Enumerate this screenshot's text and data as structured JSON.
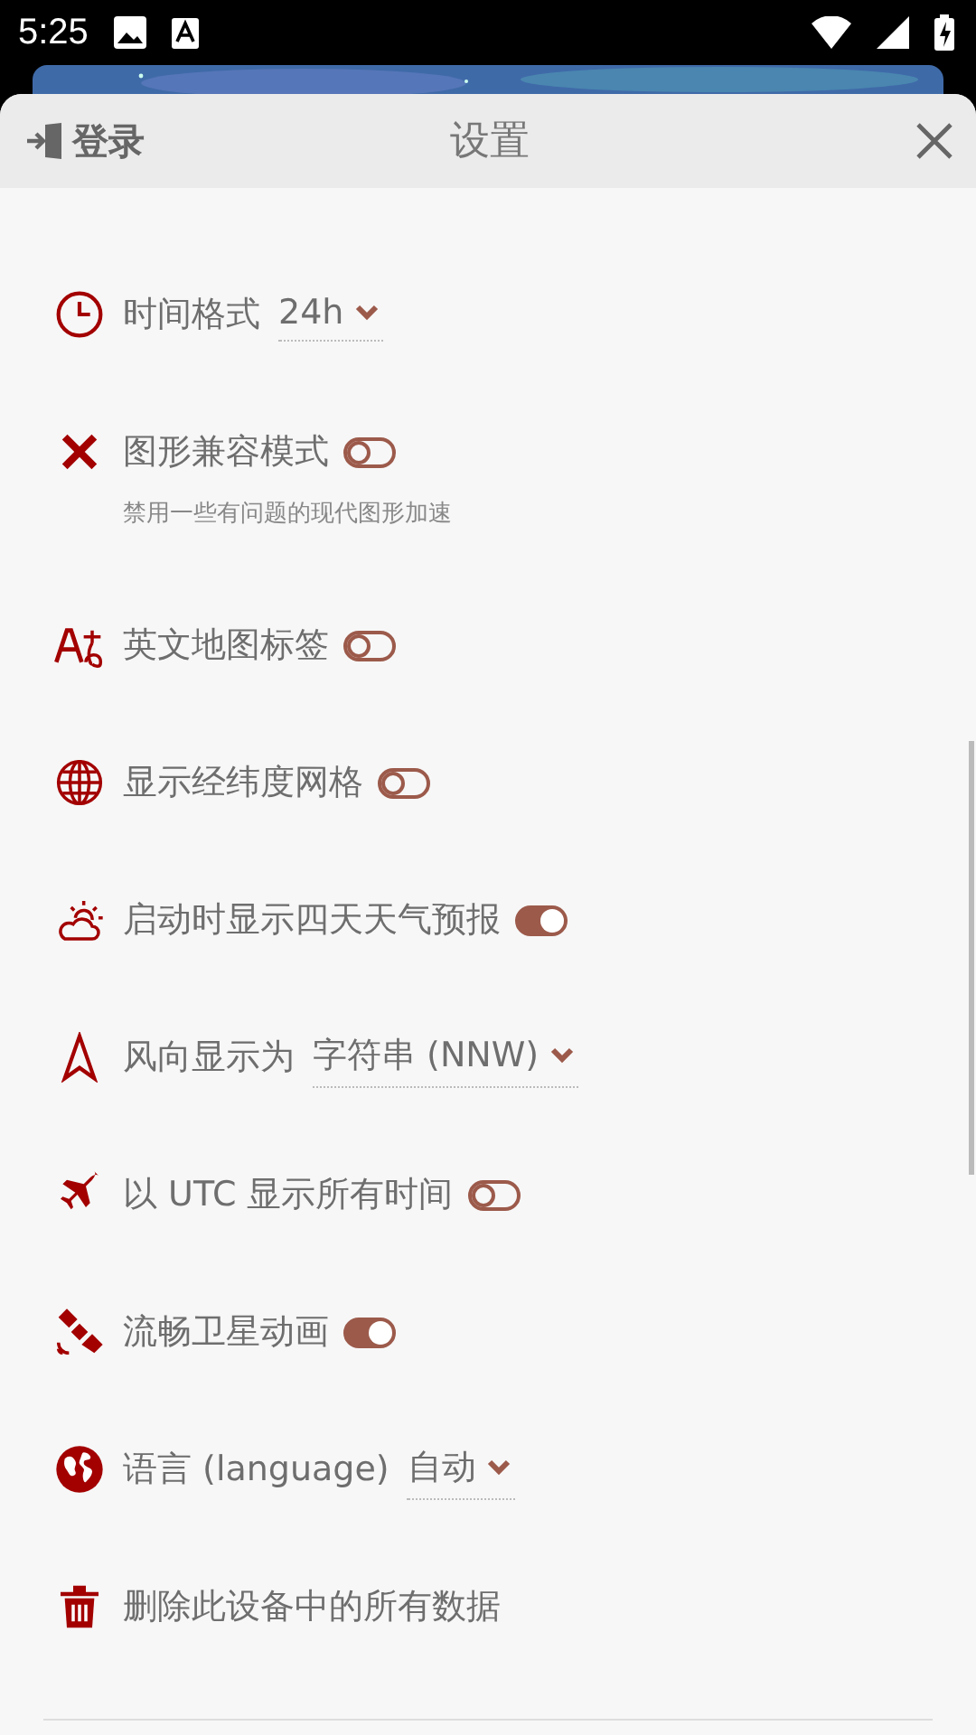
{
  "status_bar": {
    "time": "5:25"
  },
  "header": {
    "login": "登录",
    "title": "设置"
  },
  "settings": [
    {
      "kind": "select",
      "label": "时间格式",
      "value": "24h"
    },
    {
      "kind": "toggle",
      "label": "图形兼容模式",
      "on": false,
      "hint": "禁用一些有问题的现代图形加速"
    },
    {
      "kind": "toggle",
      "label": "英文地图标签",
      "on": false
    },
    {
      "kind": "toggle",
      "label": "显示经纬度网格",
      "on": false
    },
    {
      "kind": "toggle",
      "label": "启动时显示四天天气预报",
      "on": true
    },
    {
      "kind": "select",
      "label": "风向显示为",
      "value": "字符串 (NNW)"
    },
    {
      "kind": "toggle",
      "label": "以 UTC 显示所有时间",
      "on": false
    },
    {
      "kind": "toggle",
      "label": "流畅卫星动画",
      "on": true
    },
    {
      "kind": "select",
      "label": "语言 (language)",
      "value": "自动"
    },
    {
      "kind": "action",
      "label": "删除此设备中的所有数据"
    }
  ]
}
